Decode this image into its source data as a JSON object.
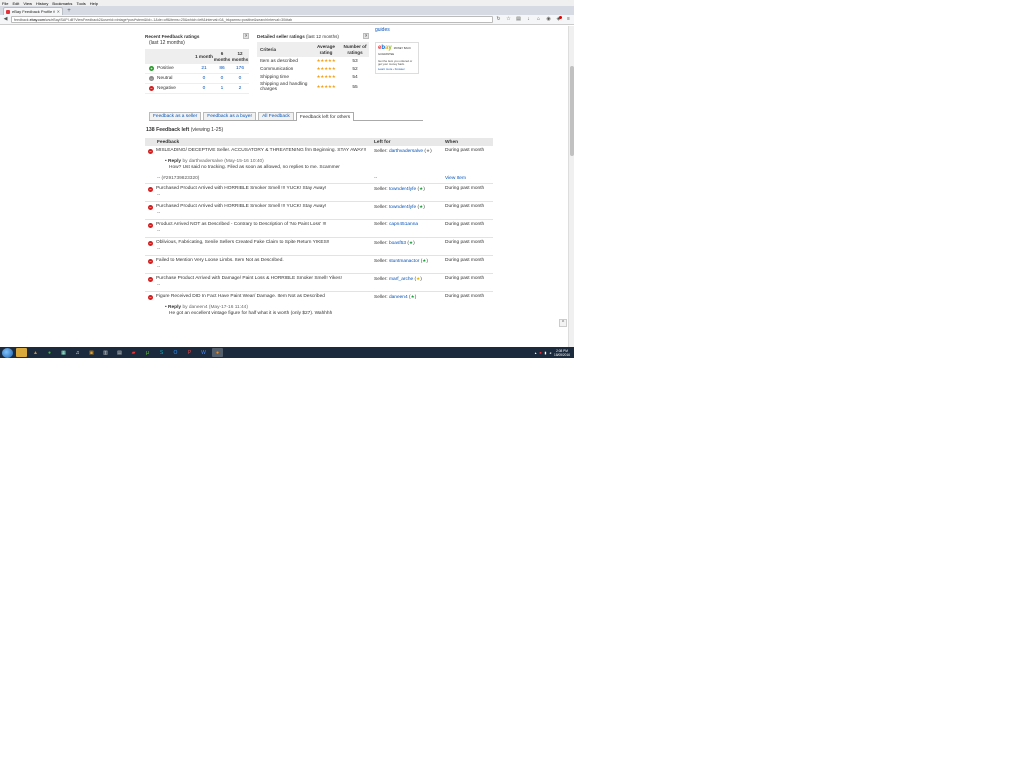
{
  "browser": {
    "menu": [
      "File",
      "Edit",
      "View",
      "History",
      "Bookmarks",
      "Tools",
      "Help"
    ],
    "tab_title": "eBay Feedback Profile for s…",
    "url_prefix": "feedback.",
    "url_host": "ebay.com",
    "url_rest": "/ws/eBayISAPI.dll?ViewFeedback2&userid=vintage*post*stem&iid=-1&de=off&items=25&which=left&interval=0&_trkparms=positive&searchInterval=30#tab"
  },
  "guides_link": "guides",
  "recent": {
    "title": "Recent Feedback ratings",
    "subtitle": "(last 12 months)",
    "help": "?",
    "headers": [
      "1 month",
      "6 months",
      "12 months"
    ],
    "rows": [
      {
        "label": "Positive",
        "values": [
          "21",
          "86",
          "176"
        ]
      },
      {
        "label": "Neutral",
        "values": [
          "0",
          "0",
          "0"
        ]
      },
      {
        "label": "Negative",
        "values": [
          "0",
          "1",
          "2"
        ]
      }
    ]
  },
  "dsr": {
    "title": "Detailed seller ratings",
    "subtitle": "(last 12 months)",
    "help": "?",
    "headers": {
      "criteria": "Criteria",
      "avg": "Average rating",
      "num": "Number of ratings"
    },
    "stars": "★★★★★",
    "rows": [
      {
        "label": "Item as described",
        "count": "53"
      },
      {
        "label": "Communication",
        "count": "52"
      },
      {
        "label": "Shipping time",
        "count": "54"
      },
      {
        "label": "Shipping and handling charges",
        "count": "55"
      }
    ]
  },
  "money_back": {
    "tag": "MONEY BACK GUARANTEE",
    "text": "Get the item you ordered or get your money back.",
    "link": "Learn more › browser"
  },
  "tabs": [
    "Feedback as a seller",
    "Feedback as a buyer",
    "All Feedback",
    "Feedback left for others"
  ],
  "count": {
    "bold": "138 Feedback left",
    "rest": " (viewing 1-25)"
  },
  "table": {
    "headers": [
      "Feedback",
      "Left for",
      "When"
    ],
    "rows": [
      {
        "text": "MISLEADING/ DECEPTIVE Seller. ACCUSATORY & THREATENING frm Beginning. STAY AWAY!!",
        "seller_prefix": "Seller:",
        "seller": "darthvadersalve",
        "star": "★",
        "when": "During past month",
        "reply_label": "Reply",
        "reply_meta": "by darthvadersalve (May-15-16 10:40)",
        "reply_text": "How? Ust said no tracking. Filed as soon as allowed, no replies to me. Scammer",
        "item": "-- (#291739823320)",
        "item_left": "--",
        "item_link": "View Item"
      },
      {
        "text": "Purchased Product Arrived with HORRIBLE Smoker Smell !!! YUCK! Stay Away!",
        "seller_prefix": "Seller:",
        "seller": "townder4lyfe",
        "star": "★",
        "when": "During past month",
        "sub": "--",
        "sub2": "--"
      },
      {
        "text": "Purchased Product Arrived with HORRIBLE Smoker Smell !!! YUCK! Stay Away!",
        "seller_prefix": "Seller:",
        "seller": "townder4lyfe",
        "star": "★",
        "when": "During past month",
        "sub": "--",
        "sub2": "--"
      },
      {
        "text": "Product Arrived NOT as Described - Contrary to Description of 'No Paint Loss' !!!",
        "seller_prefix": "Seller:",
        "seller": "capn451anna",
        "star": "",
        "when": "During past month",
        "sub": "--",
        "sub2": "--"
      },
      {
        "text": "Oblivious, Fabricating, Senile Sellers Created Fake Claim to Spite Return YIKES!!",
        "seller_prefix": "Seller:",
        "seller": "boasf53",
        "star": "★",
        "when": "During past month",
        "sub": "--",
        "sub2": "--"
      },
      {
        "text": "Failed to Mention Very Loose Limbs. Item Not as Described.",
        "seller_prefix": "Seller:",
        "seller": "stuntmanactor",
        "star": "★",
        "when": "During past month",
        "sub": "--",
        "sub2": "--"
      },
      {
        "text": "Purchase Product Arrived with Damage/ Paint Loss & HORRIBLE Smoker Smell! Yikes!",
        "seller_prefix": "Seller:",
        "seller": "marf_arche",
        "star": "★",
        "star_color": "yellow",
        "when": "During past month",
        "sub": "--",
        "sub2": "--"
      },
      {
        "text": "Figure Received DID In Fact Have Paint Wear/ Damage. Item Not as Described",
        "seller_prefix": "Seller:",
        "seller": "daneen4",
        "star": "★",
        "when": "During past month",
        "reply_label": "Reply",
        "reply_meta": "by daneen4 (May-17-16 11:44)",
        "reply_text": "He got an excellent vintage figure for half what it is worth (only $27). Wahhhh"
      }
    ]
  },
  "back_to_top": "^",
  "taskbar": {
    "time": "2:08 PM",
    "date": "18/05/2016"
  },
  "colors": {
    "link": "#0654ba",
    "negative": "#d21e1e",
    "positive": "#2c9b2c",
    "star": "#f5a21b"
  }
}
